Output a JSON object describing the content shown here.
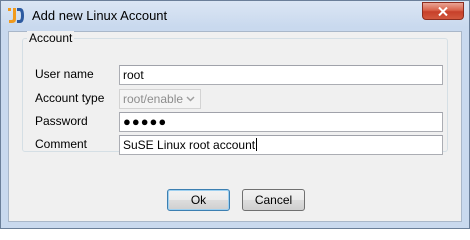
{
  "window": {
    "title": "Add new Linux Account",
    "app_icon": "jd-logo-icon",
    "close_icon": "close-icon"
  },
  "group": {
    "legend": "Account"
  },
  "form": {
    "username": {
      "label": "User name",
      "value": "root"
    },
    "account_type": {
      "label": "Account type",
      "value": "root/enable",
      "icon": "chevron-down-icon"
    },
    "password": {
      "label": "Password",
      "masked_value": "●●●●●"
    },
    "comment": {
      "label": "Comment",
      "value": "SuSE Linux root account"
    }
  },
  "buttons": {
    "ok": "Ok",
    "cancel": "Cancel"
  },
  "colors": {
    "titlebar": "#c9d9ee",
    "client_bg": "#f0f0f0",
    "close_button": "#c7402a",
    "default_button_border": "#3c7fb1"
  }
}
